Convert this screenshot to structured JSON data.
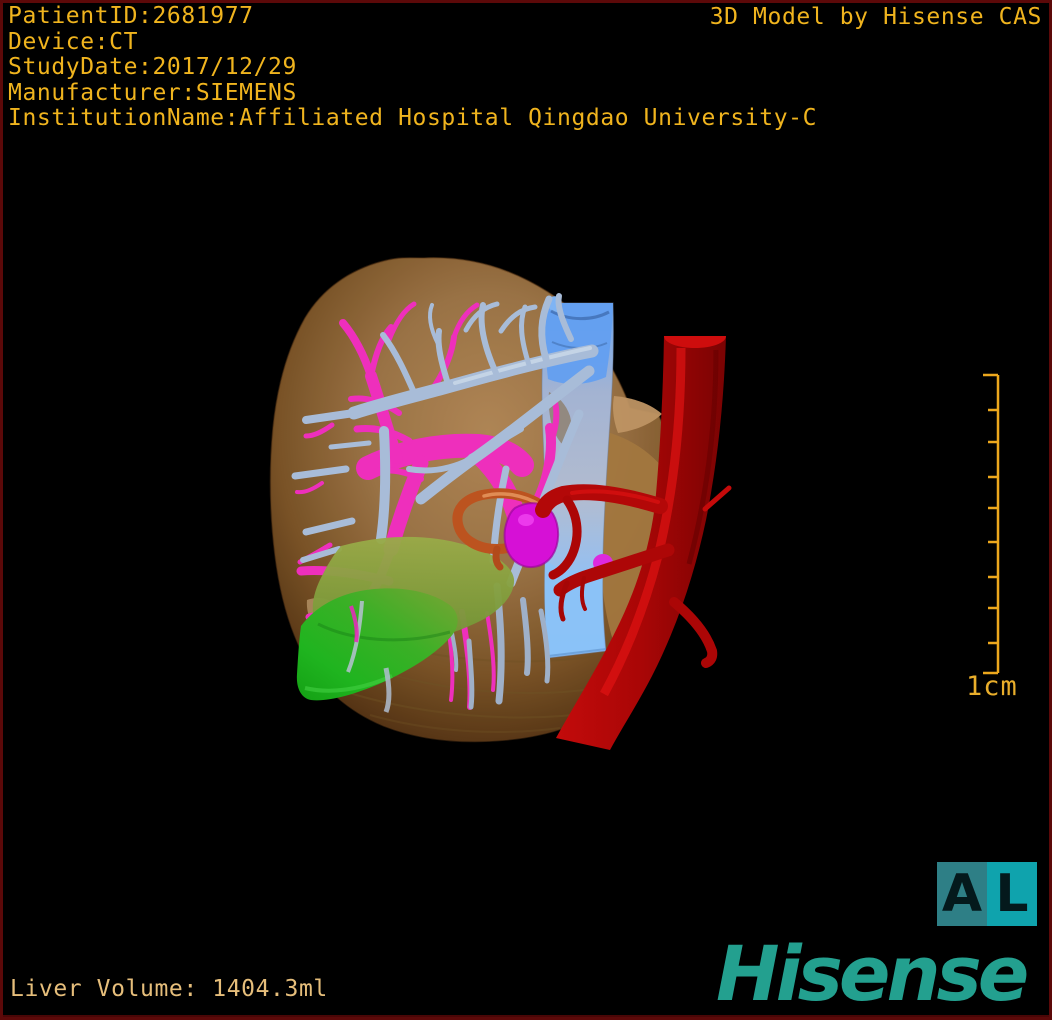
{
  "overlay": {
    "patient_info_lines": [
      "PatientID:2681977",
      "Device:CT",
      "StudyDate:2017/12/29",
      "Manufacturer:SIEMENS",
      "InstitutionName:Affiliated Hospital Qingdao University-C"
    ],
    "title": "3D Model by Hisense CAS",
    "text_color": "#F0B41E"
  },
  "viewport": {
    "background": "#000000",
    "border_color": "#5C0909",
    "structures": [
      {
        "name": "liver",
        "color": "#9C7343",
        "style": "translucent"
      },
      {
        "name": "hepatic-veins",
        "color": "#A8BCD8"
      },
      {
        "name": "portal-vein-branches",
        "color": "#EE2FBC"
      },
      {
        "name": "portal-confluence-mass",
        "color": "#D610D6"
      },
      {
        "name": "inferior-vena-cava",
        "color": "#7FB4F2"
      },
      {
        "name": "aorta",
        "color": "#AD0707"
      },
      {
        "name": "gallbladder",
        "color": "#23B723"
      },
      {
        "name": "bile-duct-loop",
        "color": "#BC531F"
      }
    ]
  },
  "scale_bar": {
    "label": "1cm",
    "tick_count": 10,
    "color": "#ECA71D"
  },
  "orientation_marker": {
    "left_letter": "A",
    "right_letter": "L",
    "left_box_color": "#2E7F86",
    "right_box_color": "#0FA3AD"
  },
  "footer": {
    "liver_volume": "Liver Volume: 1404.3ml",
    "volume_color": "#E6BE7B",
    "logo_text": "Hisense",
    "logo_color": "#23A08F"
  }
}
